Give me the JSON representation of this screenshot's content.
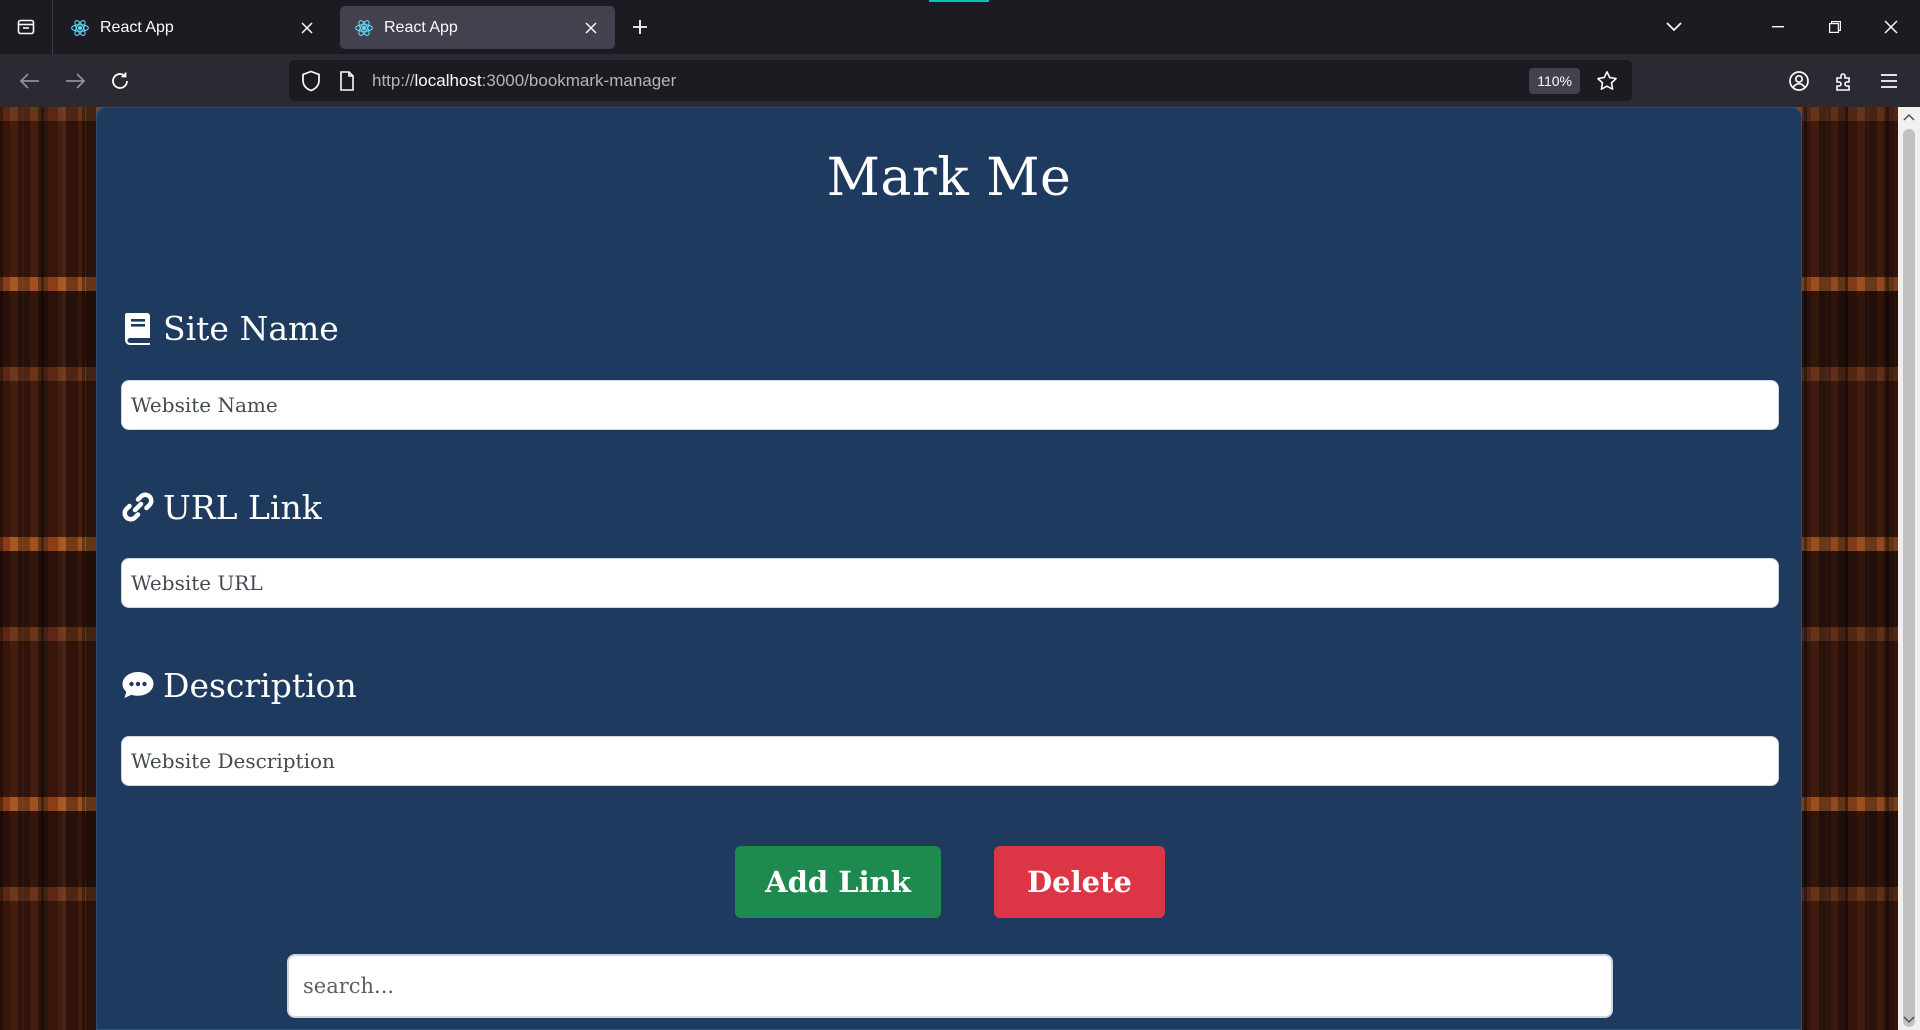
{
  "browser": {
    "tabs": [
      {
        "title": "React App",
        "active": false
      },
      {
        "title": "React App",
        "active": true
      }
    ],
    "url_scheme": "http://",
    "url_host": "localhost",
    "url_path": ":3000/bookmark-manager",
    "zoom": "110%"
  },
  "page": {
    "title": "Mark Me",
    "site_name": {
      "label": "Site Name",
      "placeholder": "Website Name",
      "icon": "book-icon"
    },
    "url_link": {
      "label": "URL Link",
      "placeholder": "Website URL",
      "icon": "link-icon"
    },
    "description": {
      "label": "Description",
      "placeholder": "Website Description",
      "icon": "comment-icon"
    },
    "add_button": "Add Link",
    "delete_button": "Delete",
    "search_placeholder": "search..."
  },
  "colors": {
    "card_bg": "#1e3a5f",
    "add_button": "#1e8a4f",
    "delete_button": "#dc3545"
  }
}
